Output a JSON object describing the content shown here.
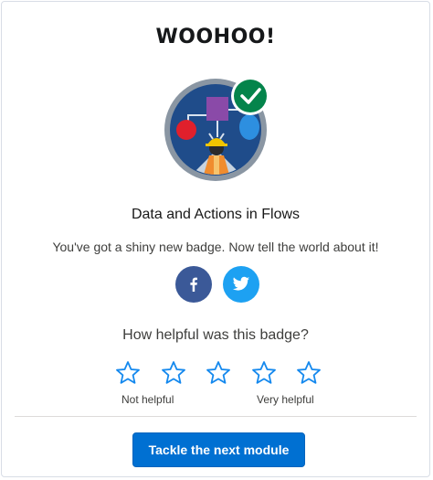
{
  "modal": {
    "title": "WOOHOO!",
    "badge_name": "Data and Actions in Flows",
    "subtitle": "You've got a shiny new badge. Now tell the world about it!"
  },
  "share": {
    "facebook_icon": "facebook-icon",
    "twitter_icon": "twitter-icon",
    "facebook_color": "#3b5998",
    "twitter_color": "#1da1f2"
  },
  "rating": {
    "question": "How helpful was this badge?",
    "star_count": 5,
    "selected": 0,
    "low_label": "Not helpful",
    "high_label": "Very helpful",
    "star_color": "#1589ee"
  },
  "footer": {
    "next_button": "Tackle the next module",
    "button_color": "#0070d2"
  }
}
